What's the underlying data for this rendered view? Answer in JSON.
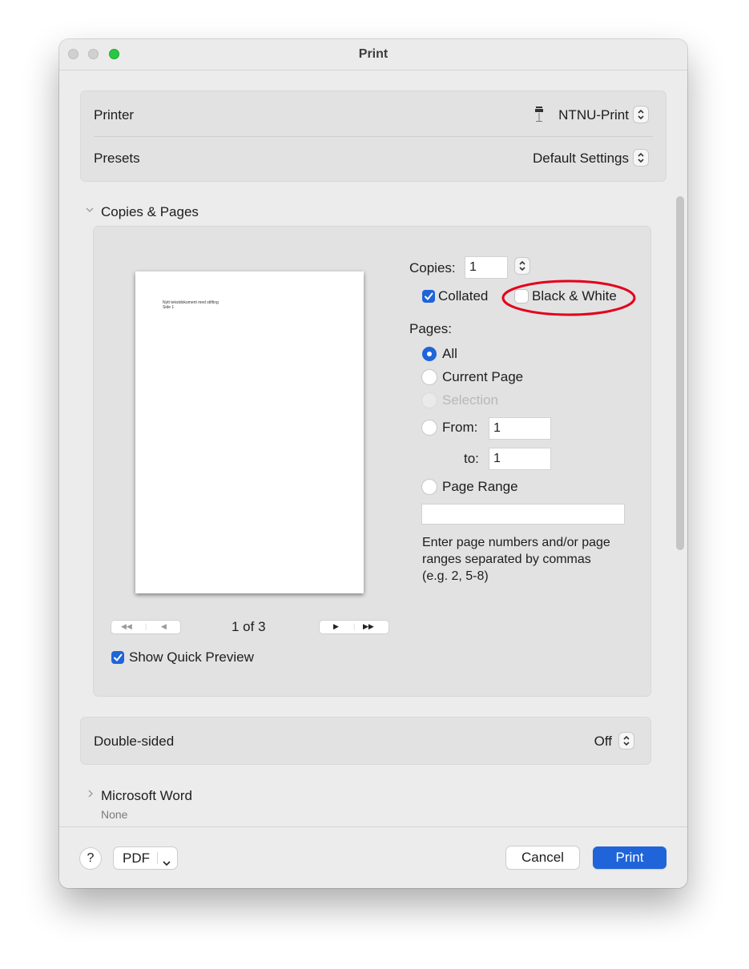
{
  "window": {
    "title": "Print"
  },
  "printer": {
    "label": "Printer",
    "value": "NTNU-Print",
    "icon": "printer-icon"
  },
  "presets": {
    "label": "Presets",
    "value": "Default Settings"
  },
  "copies_pages": {
    "section_title": "Copies & Pages",
    "preview": {
      "text_line1": "Nytt tekstdokument med stifting",
      "text_line2": "Side 1",
      "page_indicator": "1 of 3"
    },
    "show_quick_preview": {
      "label": "Show Quick Preview",
      "checked": true
    },
    "copies": {
      "label": "Copies:",
      "value": "1"
    },
    "collated": {
      "label": "Collated",
      "checked": true
    },
    "black_white": {
      "label": "Black & White",
      "checked": false,
      "highlight_color": "#e3001b"
    },
    "pages": {
      "label": "Pages:",
      "all": "All",
      "current_page": "Current Page",
      "selection": "Selection",
      "from_label": "From:",
      "from_value": "1",
      "to_label": "to:",
      "to_value": "1",
      "page_range": "Page Range",
      "page_range_value": "",
      "hint": "Enter page numbers and/or page ranges separated by commas (e.g. 2, 5-8)"
    }
  },
  "double_sided": {
    "label": "Double-sided",
    "value": "Off"
  },
  "microsoft_word": {
    "title": "Microsoft Word",
    "subtitle": "None"
  },
  "footer": {
    "help": "?",
    "pdf": "PDF",
    "cancel": "Cancel",
    "print": "Print"
  },
  "colors": {
    "accent": "#1f64d8",
    "window_bg": "#ececec"
  }
}
